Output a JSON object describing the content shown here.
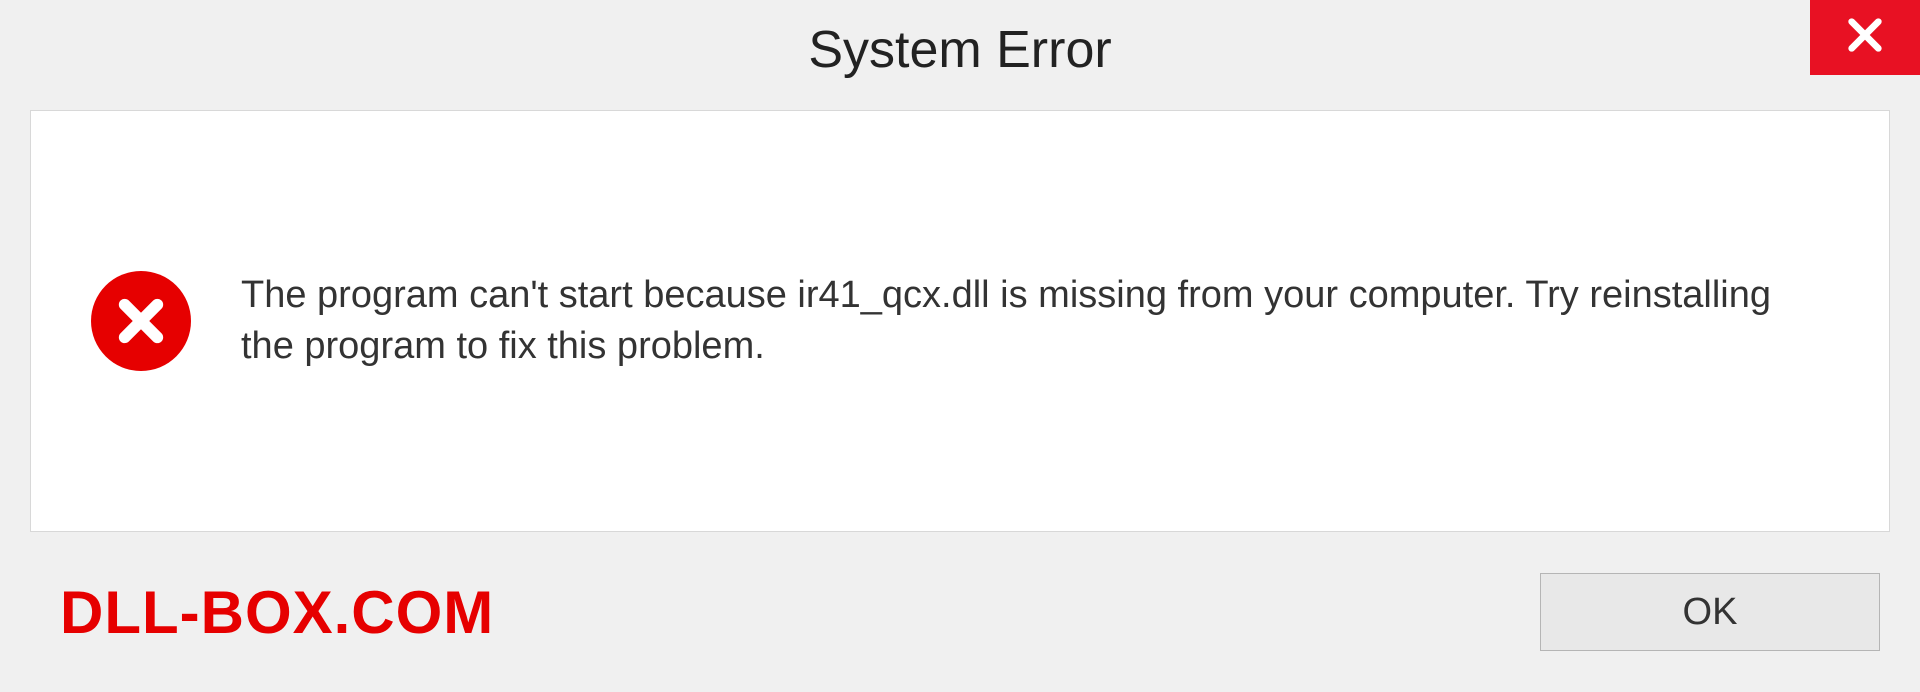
{
  "dialog": {
    "title": "System Error",
    "message": "The program can't start because ir41_qcx.dll is missing from your computer. Try reinstalling the program to fix this problem.",
    "ok_label": "OK"
  },
  "watermark": "DLL-BOX.COM"
}
